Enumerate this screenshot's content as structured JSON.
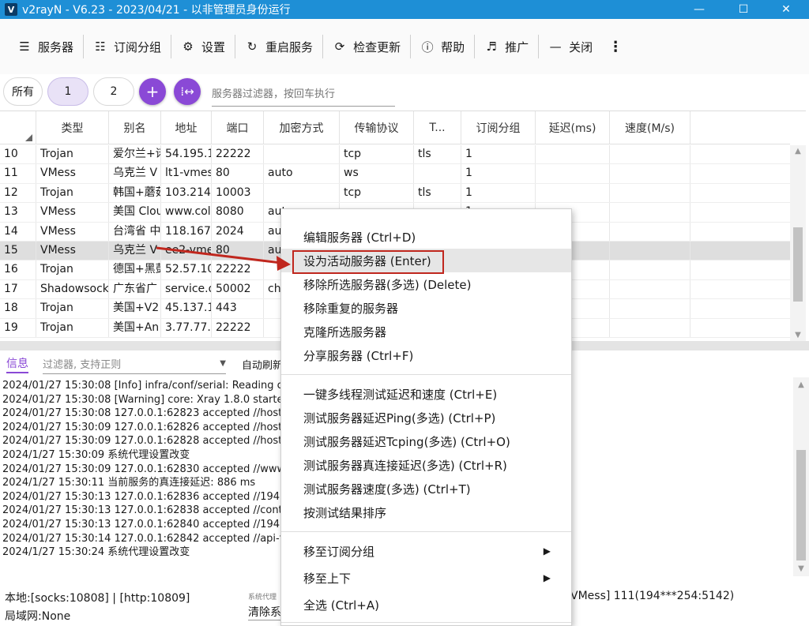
{
  "window": {
    "title": "v2rayN - V6.23 - 2023/04/21 - 以非管理员身份运行",
    "icon": "V"
  },
  "toolbar": {
    "items": [
      {
        "label": "服务器",
        "icon": "server-icon"
      },
      {
        "label": "订阅分组",
        "icon": "subscription-icon"
      },
      {
        "label": "设置",
        "icon": "gear-icon"
      },
      {
        "label": "重启服务",
        "icon": "restart-icon"
      },
      {
        "label": "检查更新",
        "icon": "update-icon"
      },
      {
        "label": "帮助",
        "icon": "help-icon"
      },
      {
        "label": "推广",
        "icon": "speaker-icon"
      },
      {
        "label": "关闭",
        "icon": "minus-icon"
      }
    ]
  },
  "groups": {
    "all": "所有",
    "g1": "1",
    "g2": "2",
    "filter_placeholder": "服务器过滤器，按回车执行"
  },
  "table": {
    "headers": [
      "类型",
      "别名",
      "地址",
      "端口",
      "加密方式",
      "传输协议",
      "T...",
      "订阅分组",
      "延迟(ms)",
      "速度(M/s)"
    ],
    "rows": [
      {
        "n": "10",
        "type": "Trojan",
        "alias": "爱尔兰+诺",
        "addr": "54.195.1",
        "port": "22222",
        "enc": "",
        "net": "tcp",
        "tls": "tls",
        "sub": "1"
      },
      {
        "n": "11",
        "type": "VMess",
        "alias": "乌克兰 V",
        "addr": "lt1-vmes",
        "port": "80",
        "enc": "auto",
        "net": "ws",
        "tls": "",
        "sub": "1"
      },
      {
        "n": "12",
        "type": "Trojan",
        "alias": "韩国+蘑菇",
        "addr": "103.214.",
        "port": "10003",
        "enc": "",
        "net": "tcp",
        "tls": "tls",
        "sub": "1"
      },
      {
        "n": "13",
        "type": "VMess",
        "alias": "美国 Clou",
        "addr": "www.col",
        "port": "8080",
        "enc": "auto",
        "net": "",
        "tls": "",
        "sub": "1"
      },
      {
        "n": "14",
        "type": "VMess",
        "alias": "台湾省 中",
        "addr": "118.167.",
        "port": "2024",
        "enc": "auto",
        "net": "",
        "tls": "",
        "sub": ""
      },
      {
        "n": "15",
        "type": "VMess",
        "alias": "乌克兰 V",
        "addr": "ee2-vme",
        "port": "80",
        "enc": "auto",
        "net": "",
        "tls": "",
        "sub": ""
      },
      {
        "n": "16",
        "type": "Trojan",
        "alias": "德国+黑彭",
        "addr": "52.57.10",
        "port": "22222",
        "enc": "",
        "net": "",
        "tls": "",
        "sub": ""
      },
      {
        "n": "17",
        "type": "Shadowsock",
        "alias": "广东省广",
        "addr": "service.o",
        "port": "50002",
        "enc": "chacha",
        "net": "",
        "tls": "",
        "sub": ""
      },
      {
        "n": "18",
        "type": "Trojan",
        "alias": "美国+V2",
        "addr": "45.137.1",
        "port": "443",
        "enc": "",
        "net": "",
        "tls": "",
        "sub": ""
      },
      {
        "n": "19",
        "type": "Trojan",
        "alias": "美国+An",
        "addr": "3.77.77.3",
        "port": "22222",
        "enc": "",
        "net": "",
        "tls": "",
        "sub": ""
      }
    ]
  },
  "log": {
    "tab": "信息",
    "filter_placeholder": "过滤器, 支持正则",
    "auto_refresh": "自动刷新",
    "lines": [
      "2024/01/27 15:30:08 [Info] infra/conf/serial: Reading config",
      "2024/01/27 15:30:08 [Warning] core: Xray 1.8.0 started",
      "2024/01/27 15:30:08 127.0.0.1:62823 accepted //hostvds",
      "2024/01/27 15:30:09 127.0.0.1:62826 accepted //hostvds",
      "2024/01/27 15:30:09 127.0.0.1:62828 accepted //hostvds",
      "2024/1/27 15:30:09 系统代理设置改变",
      "2024/01/27 15:30:09 127.0.0.1:62830 accepted //www.go",
      "2024/1/27 15:30:11 当前服务的真连接延迟: 886 ms",
      "2024/01/27 15:30:13 127.0.0.1:62836 accepted //194.36.",
      "2024/01/27 15:30:13 127.0.0.1:62838 accepted //content",
      "2024/01/27 15:30:13 127.0.0.1:62840 accepted //194.36.",
      "2024/01/27 15:30:14 127.0.0.1:62842 accepted //api-feed",
      "2024/1/27 15:30:24 系统代理设置改变"
    ]
  },
  "status": {
    "local": "本地:[socks:10808] | [http:10809]",
    "lan": "局域网:None",
    "proxy_label": "系统代理",
    "proxy_value": "清除系",
    "server": "VMess] 111(194***254:5142)"
  },
  "menu": {
    "items": [
      {
        "label": "编辑服务器 (Ctrl+D)"
      },
      {
        "label": "设为活动服务器 (Enter)"
      },
      {
        "label": "移除所选服务器(多选) (Delete)"
      },
      {
        "label": "移除重复的服务器"
      },
      {
        "label": "克隆所选服务器"
      },
      {
        "label": "分享服务器 (Ctrl+F)"
      },
      {
        "label": "一键多线程测试延迟和速度 (Ctrl+E)"
      },
      {
        "label": "测试服务器延迟Ping(多选) (Ctrl+P)"
      },
      {
        "label": "测试服务器延迟Tcping(多选) (Ctrl+O)"
      },
      {
        "label": "测试服务器真连接延迟(多选) (Ctrl+R)"
      },
      {
        "label": "测试服务器速度(多选) (Ctrl+T)"
      },
      {
        "label": "按测试结果排序"
      },
      {
        "label": "移至订阅分组"
      },
      {
        "label": "移至上下"
      },
      {
        "label": "全选 (Ctrl+A)"
      }
    ]
  },
  "colors": {
    "titlebar": "#1e8fd6",
    "accent": "#8a49d6",
    "annotation": "#c0271e"
  }
}
